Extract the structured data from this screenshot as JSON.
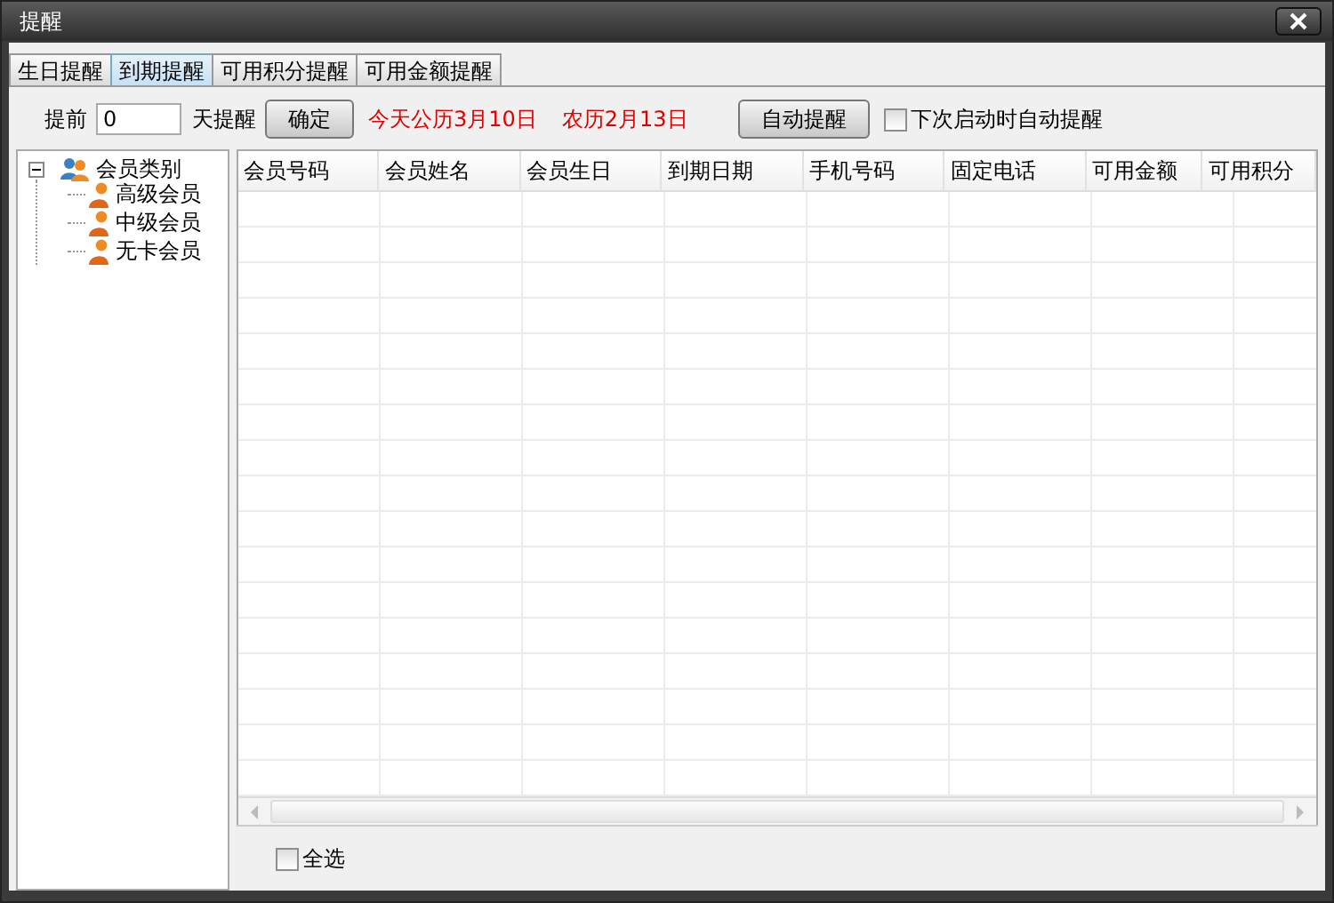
{
  "window": {
    "title": "提醒"
  },
  "tabs": [
    {
      "label": "生日提醒",
      "selected": false
    },
    {
      "label": "到期提醒",
      "selected": true
    },
    {
      "label": "可用积分提醒",
      "selected": false
    },
    {
      "label": "可用金额提醒",
      "selected": false
    }
  ],
  "toolbar": {
    "before_label": "提前",
    "days": "0",
    "after_label": "天提醒",
    "confirm_button": "确定",
    "solar_date": "今天公历3月10日",
    "lunar_date": "农历2月13日",
    "auto_button": "自动提醒",
    "auto_on_start": {
      "label": "下次启动时自动提醒",
      "checked": false
    }
  },
  "tree": [
    {
      "label": "会员类别",
      "expanded": true,
      "children": [
        {
          "label": "高级会员"
        },
        {
          "label": "中级会员"
        },
        {
          "label": "无卡会员"
        }
      ]
    }
  ],
  "table": {
    "columns": [
      "会员号码",
      "会员姓名",
      "会员生日",
      "到期日期",
      "手机号码",
      "固定电话",
      "可用金额",
      "可用积分"
    ]
  },
  "select_all": {
    "label": "全选",
    "checked": false
  }
}
